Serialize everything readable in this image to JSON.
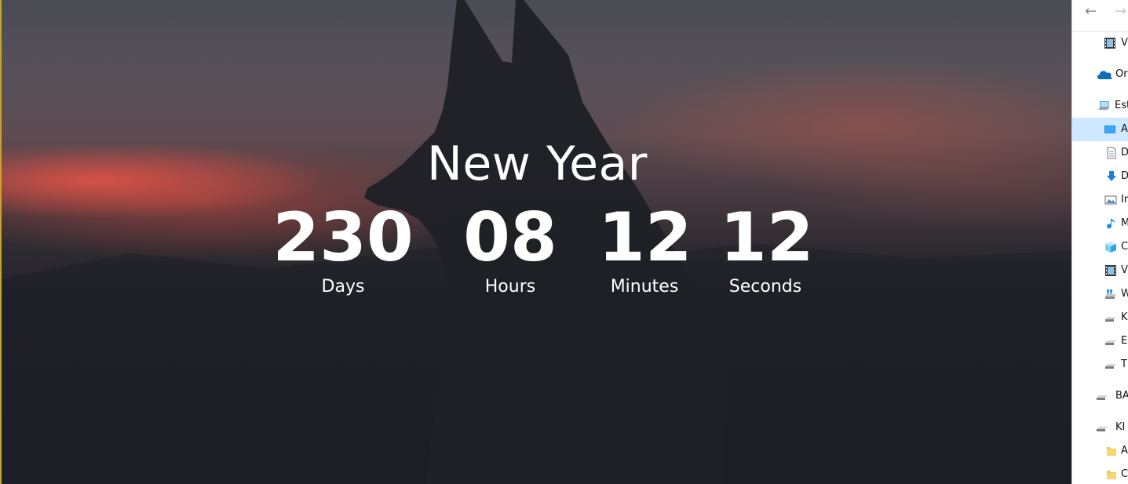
{
  "countdown": {
    "title": "New Year",
    "days": {
      "value": "230",
      "label": "Days"
    },
    "hours": {
      "value": "08",
      "label": "Hours"
    },
    "minutes": {
      "value": "12",
      "label": "Minutes"
    },
    "seconds": {
      "value": "12",
      "label": "Seconds"
    }
  },
  "explorer": {
    "nav": {
      "back_icon": "arrow-left-icon",
      "forward_icon": "arrow-right-icon"
    },
    "items": [
      {
        "label": "V",
        "icon": "video-icon"
      },
      {
        "label": "Or",
        "icon": "onedrive-icon"
      },
      {
        "label": "Est",
        "icon": "computer-icon"
      },
      {
        "label": "A",
        "icon": "desktop-icon",
        "selected": true
      },
      {
        "label": "D",
        "icon": "document-icon"
      },
      {
        "label": "D",
        "icon": "download-icon"
      },
      {
        "label": "Ir",
        "icon": "image-icon"
      },
      {
        "label": "M",
        "icon": "music-icon"
      },
      {
        "label": "C",
        "icon": "3d-objects-icon"
      },
      {
        "label": "V",
        "icon": "video-icon"
      },
      {
        "label": "W",
        "icon": "windows-drive-icon"
      },
      {
        "label": "K",
        "icon": "drive-icon"
      },
      {
        "label": "E",
        "icon": "drive-icon"
      },
      {
        "label": "T",
        "icon": "drive-icon"
      },
      {
        "label": "BA",
        "icon": "drive-icon"
      },
      {
        "label": "KI",
        "icon": "drive-icon"
      },
      {
        "label": "A",
        "icon": "folder-icon"
      },
      {
        "label": "C",
        "icon": "folder-icon"
      }
    ]
  }
}
